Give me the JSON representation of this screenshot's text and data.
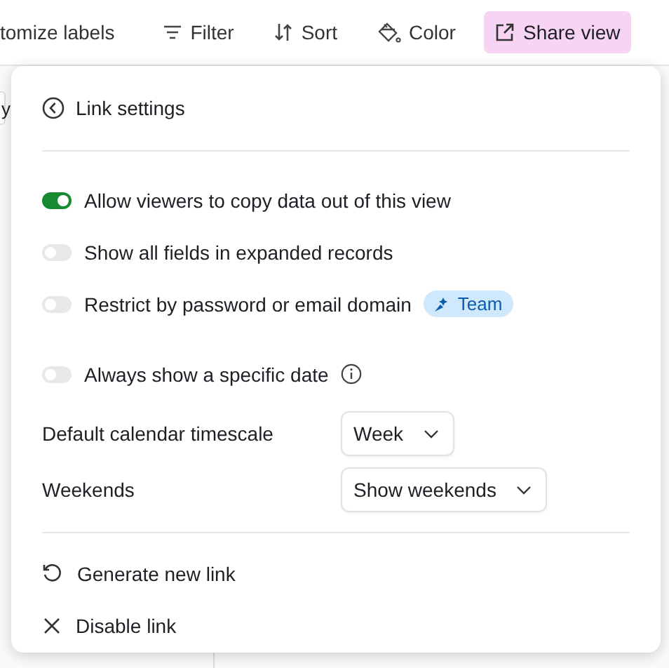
{
  "toolbar": {
    "items": [
      {
        "kind": "labels",
        "label": "tomize labels",
        "selected": false
      },
      {
        "kind": "filter",
        "label": "Filter",
        "selected": false
      },
      {
        "kind": "sort",
        "label": "Sort",
        "selected": false
      },
      {
        "kind": "color",
        "label": "Color",
        "selected": false
      },
      {
        "kind": "share",
        "label": "Share view",
        "selected": true
      }
    ]
  },
  "background": {
    "cell_fragment": "y"
  },
  "popover": {
    "title": "Link settings",
    "toggles": [
      {
        "label": "Allow viewers to copy data out of this view",
        "on": true
      },
      {
        "label": "Show all fields in expanded records",
        "on": false
      },
      {
        "label": "Restrict by password or email domain",
        "on": false,
        "badge": "Team"
      },
      {
        "label": "Always show a specific date",
        "on": false,
        "info": true
      }
    ],
    "selects": [
      {
        "label": "Default calendar timescale",
        "value": "Week"
      },
      {
        "label": "Weekends",
        "value": "Show weekends"
      }
    ],
    "actions": [
      {
        "kind": "regenerate",
        "label": "Generate new link"
      },
      {
        "kind": "disable",
        "label": "Disable link"
      }
    ]
  }
}
